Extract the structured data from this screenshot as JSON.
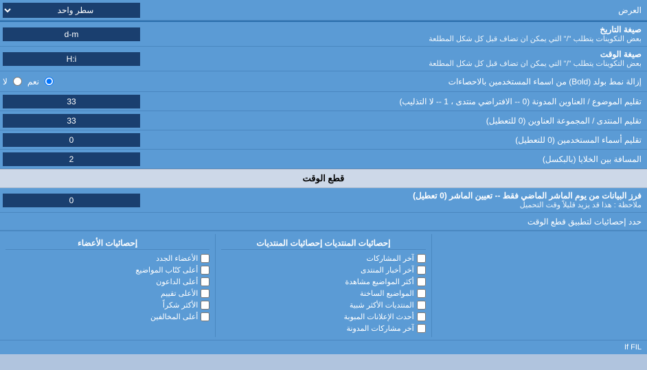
{
  "header": {
    "title": "العرض",
    "single_line_label": "سطر واحد"
  },
  "rows": [
    {
      "id": "date_format",
      "label": "صيغة التاريخ",
      "sublabel": "بعض التكوينات يتطلب \"/\" التي يمكن ان تضاف قبل كل شكل المطلعة",
      "value": "d-m",
      "type": "text"
    },
    {
      "id": "time_format",
      "label": "صيغة الوقت",
      "sublabel": "بعض التكوينات يتطلب \"/\" التي يمكن ان تضاف قبل كل شكل المطلعة",
      "value": "H:i",
      "type": "text"
    },
    {
      "id": "bold_remove",
      "label": "إزالة نمط بولد (Bold) من اسماء المستخدمين بالاحصاءات",
      "type": "radio",
      "options": [
        "نعم",
        "لا"
      ],
      "selected": "نعم"
    },
    {
      "id": "topic_title_trim",
      "label": "تقليم الموضوع / العناوين المدونة (0 -- الافتراضي منتدى ، 1 -- لا التذليب)",
      "value": "33",
      "type": "number"
    },
    {
      "id": "forum_title_trim",
      "label": "تقليم المنتدى / المجموعة العناوين (0 للتعطيل)",
      "value": "33",
      "type": "number"
    },
    {
      "id": "username_trim",
      "label": "تقليم أسماء المستخدمين (0 للتعطيل)",
      "value": "0",
      "type": "number"
    },
    {
      "id": "cell_spacing",
      "label": "المسافة بين الخلايا (بالبكسل)",
      "value": "2",
      "type": "number"
    }
  ],
  "cutoff_section": {
    "title": "قطع الوقت",
    "row": {
      "label": "فرز البيانات من يوم الماشر الماضي فقط -- تعيين الماشر (0 تعطيل)",
      "sublabel": "ملاحظة : هذا قد يزيد قليلاً وقت التحميل",
      "value": "0"
    },
    "stats_label": "حدد إحصائيات لتطبيق قطع الوقت"
  },
  "checkboxes": {
    "col1_header": "",
    "col2_header": "إحصائيات المنتديات",
    "col3_header": "إحصائيات الأعضاء",
    "col2_items": [
      "آخر المشاركات",
      "آخر أخبار المنتدى",
      "أكثر المواضيع مشاهدة",
      "المواضيع الساخنة",
      "المنتديات الأكثر شبية",
      "أحدث الإعلانات المبوبة",
      "آخر مشاركات المدونة"
    ],
    "col3_items": [
      "الأعضاء الجدد",
      "أعلى كتّاب المواضيع",
      "أعلى الداعون",
      "الأعلى تقييم",
      "الأكثر شكراً",
      "أعلى المخالفين"
    ],
    "col2_checked": [
      false,
      false,
      false,
      false,
      false,
      false,
      false
    ],
    "col3_checked": [
      false,
      false,
      false,
      false,
      false,
      false
    ]
  },
  "bottom_note": "If FIL"
}
